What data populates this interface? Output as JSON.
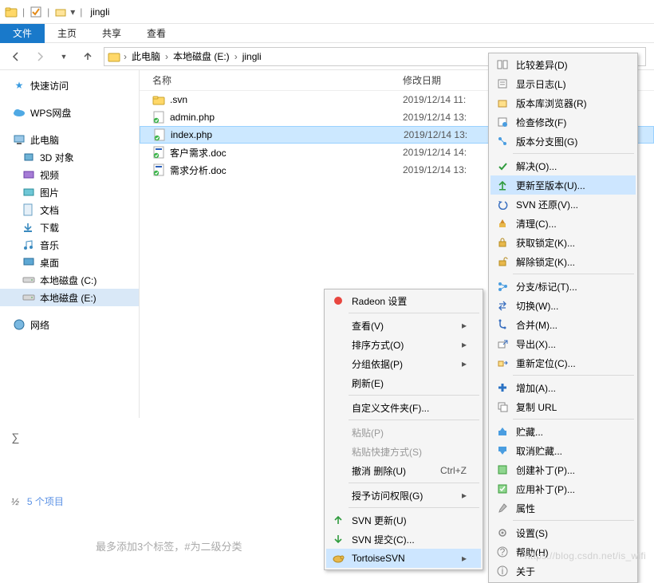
{
  "titlebar": {
    "title": "jingli"
  },
  "ribbon": {
    "file": "文件",
    "home": "主页",
    "share": "共享",
    "view": "查看"
  },
  "nav": {
    "crumbs": [
      "此电脑",
      "本地磁盘 (E:)",
      "jingli"
    ]
  },
  "sidebar": {
    "quick_access": "快速访问",
    "wps": "WPS网盘",
    "this_pc": "此电脑",
    "items": [
      {
        "icon": "cube",
        "label": "3D 对象"
      },
      {
        "icon": "video",
        "label": "视频"
      },
      {
        "icon": "image",
        "label": "图片"
      },
      {
        "icon": "doc",
        "label": "文档"
      },
      {
        "icon": "download",
        "label": "下载"
      },
      {
        "icon": "music",
        "label": "音乐"
      },
      {
        "icon": "desktop",
        "label": "桌面"
      },
      {
        "icon": "disk",
        "label": "本地磁盘 (C:)"
      },
      {
        "icon": "disk",
        "label": "本地磁盘 (E:)"
      }
    ],
    "network": "网络"
  },
  "filelist": {
    "col_name": "名称",
    "col_date": "修改日期",
    "rows": [
      {
        "icon": "folder",
        "name": ".svn",
        "date": "2019/12/14 11:"
      },
      {
        "icon": "php",
        "name": "admin.php",
        "date": "2019/12/14 13:"
      },
      {
        "icon": "php",
        "name": "index.php",
        "date": "2019/12/14 13:",
        "selected": true
      },
      {
        "icon": "doc",
        "name": "客户需求.doc",
        "date": "2019/12/14 14:"
      },
      {
        "icon": "doc",
        "name": "需求分析.doc",
        "date": "2019/12/14 13:"
      }
    ]
  },
  "bottom": {
    "sum_icon": "∑",
    "count_prefix": "½",
    "count_text": "5 个项目",
    "tag_hint": "最多添加3个标签，#为二级分类"
  },
  "menu1": {
    "items": [
      {
        "type": "item",
        "icon": "radeon",
        "label": "Radeon 设置"
      },
      {
        "type": "sep"
      },
      {
        "type": "item",
        "label": "查看(V)",
        "submenu": true
      },
      {
        "type": "item",
        "label": "排序方式(O)",
        "submenu": true
      },
      {
        "type": "item",
        "label": "分组依据(P)",
        "submenu": true
      },
      {
        "type": "item",
        "label": "刷新(E)"
      },
      {
        "type": "sep"
      },
      {
        "type": "item",
        "label": "自定义文件夹(F)..."
      },
      {
        "type": "sep"
      },
      {
        "type": "item",
        "label": "粘贴(P)",
        "disabled": true
      },
      {
        "type": "item",
        "label": "粘贴快捷方式(S)",
        "disabled": true
      },
      {
        "type": "item",
        "label": "撤消 删除(U)",
        "shortcut": "Ctrl+Z"
      },
      {
        "type": "sep"
      },
      {
        "type": "item",
        "label": "授予访问权限(G)",
        "submenu": true
      },
      {
        "type": "sep"
      },
      {
        "type": "item",
        "icon": "svn-update",
        "label": "SVN 更新(U)"
      },
      {
        "type": "item",
        "icon": "svn-commit",
        "label": "SVN 提交(C)..."
      },
      {
        "type": "item",
        "icon": "tortoise",
        "label": "TortoiseSVN",
        "submenu": true,
        "highlight": true
      }
    ]
  },
  "menu2": {
    "items": [
      {
        "type": "item",
        "icon": "diff",
        "label": "比较差异(D)"
      },
      {
        "type": "item",
        "icon": "log",
        "label": "显示日志(L)"
      },
      {
        "type": "item",
        "icon": "repo",
        "label": "版本库浏览器(R)"
      },
      {
        "type": "item",
        "icon": "check",
        "label": "检查修改(F)"
      },
      {
        "type": "item",
        "icon": "graph",
        "label": "版本分支图(G)"
      },
      {
        "type": "sep"
      },
      {
        "type": "item",
        "icon": "resolve",
        "label": "解决(O)..."
      },
      {
        "type": "item",
        "icon": "update-rev",
        "label": "更新至版本(U)...",
        "highlight": true
      },
      {
        "type": "item",
        "icon": "revert",
        "label": "SVN 还原(V)..."
      },
      {
        "type": "item",
        "icon": "cleanup",
        "label": "清理(C)..."
      },
      {
        "type": "item",
        "icon": "lock",
        "label": "获取锁定(K)..."
      },
      {
        "type": "item",
        "icon": "unlock",
        "label": "解除锁定(K)..."
      },
      {
        "type": "sep"
      },
      {
        "type": "item",
        "icon": "branch",
        "label": "分支/标记(T)..."
      },
      {
        "type": "item",
        "icon": "switch",
        "label": "切换(W)..."
      },
      {
        "type": "item",
        "icon": "merge",
        "label": "合并(M)..."
      },
      {
        "type": "item",
        "icon": "export",
        "label": "导出(X)..."
      },
      {
        "type": "item",
        "icon": "relocate",
        "label": "重新定位(C)..."
      },
      {
        "type": "sep"
      },
      {
        "type": "item",
        "icon": "add",
        "label": "增加(A)..."
      },
      {
        "type": "item",
        "icon": "copyurl",
        "label": "复制 URL"
      },
      {
        "type": "sep"
      },
      {
        "type": "item",
        "icon": "shelve",
        "label": "贮藏..."
      },
      {
        "type": "item",
        "icon": "unshelve",
        "label": "取消贮藏..."
      },
      {
        "type": "item",
        "icon": "patch-create",
        "label": "创建补丁(P)..."
      },
      {
        "type": "item",
        "icon": "patch-apply",
        "label": "应用补丁(P)..."
      },
      {
        "type": "item",
        "icon": "props",
        "label": "属性"
      },
      {
        "type": "sep"
      },
      {
        "type": "item",
        "icon": "settings",
        "label": "设置(S)"
      },
      {
        "type": "item",
        "icon": "help",
        "label": "帮助(H)"
      },
      {
        "type": "item",
        "icon": "about",
        "label": "关于"
      }
    ]
  },
  "watermark": "https://blog.csdn.net/is_wifi"
}
